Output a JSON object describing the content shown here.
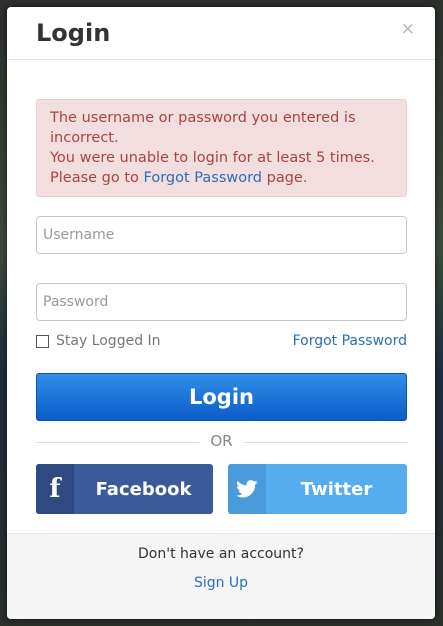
{
  "modal": {
    "title": "Login",
    "close_label": "×"
  },
  "alert": {
    "line1": "The username or password you entered is incorrect.",
    "line2": "You were unable to login for at least 5 times.",
    "line3_prefix": "Please go to ",
    "line3_link": "Forgot Password",
    "line3_suffix": " page."
  },
  "form": {
    "username_placeholder": "Username",
    "username_value": "",
    "password_placeholder": "Password",
    "password_value": "",
    "stay_logged_in_label": "Stay Logged In",
    "stay_logged_in_checked": false,
    "forgot_password_label": "Forgot Password",
    "login_button_label": "Login",
    "or_label": "OR"
  },
  "social": {
    "facebook_icon": "f",
    "facebook_label": "Facebook",
    "twitter_label": "Twitter"
  },
  "footer": {
    "prompt": "Don't have an account?",
    "signup_label": "Sign Up"
  },
  "colors": {
    "primary": "#0b5cc8",
    "facebook": "#3b5a9a",
    "twitter": "#55acee",
    "error_text": "#a94442",
    "error_bg": "#f2dede",
    "link": "#2a6fb8"
  }
}
